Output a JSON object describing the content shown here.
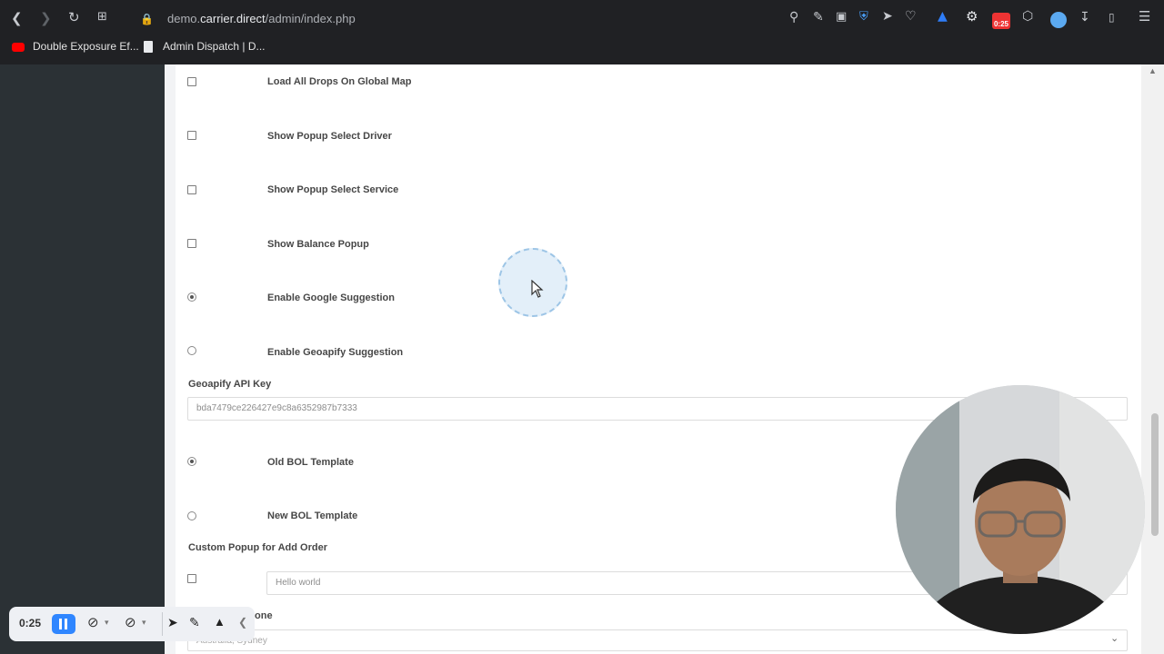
{
  "browser": {
    "url_prefix": "demo.",
    "url_domain": "carrier.direct",
    "url_path": "/admin/index.php",
    "timer_badge": "0:25"
  },
  "bookmarks": [
    {
      "label": "Double Exposure Ef..."
    },
    {
      "label": "Admin Dispatch | D..."
    }
  ],
  "settings": {
    "rows": [
      {
        "label": "Load All Drops On Global Map",
        "type": "checkbox",
        "checked": false
      },
      {
        "label": "Show Popup Select Driver",
        "type": "checkbox",
        "checked": false
      },
      {
        "label": "Show Popup Select Service",
        "type": "checkbox",
        "checked": false
      },
      {
        "label": "Show Balance Popup",
        "type": "checkbox",
        "checked": false
      },
      {
        "label": "Enable Google Suggestion",
        "type": "radio",
        "checked": true
      },
      {
        "label": "Enable Geoapify Suggestion",
        "type": "radio",
        "checked": false
      }
    ],
    "geoapify_label": "Geoapify API Key",
    "geoapify_value": "bda7479ce226427e9c8a6352987b7333",
    "bol": [
      {
        "label": "Old BOL Template",
        "checked": true
      },
      {
        "label": "New BOL Template",
        "checked": false
      }
    ],
    "popup_label": "Custom Popup for Add Order",
    "popup_value": "Hello world",
    "timezone_label_partial": "one",
    "timezone_value": "Australia, Sydney"
  },
  "recorder": {
    "time": "0:25"
  }
}
